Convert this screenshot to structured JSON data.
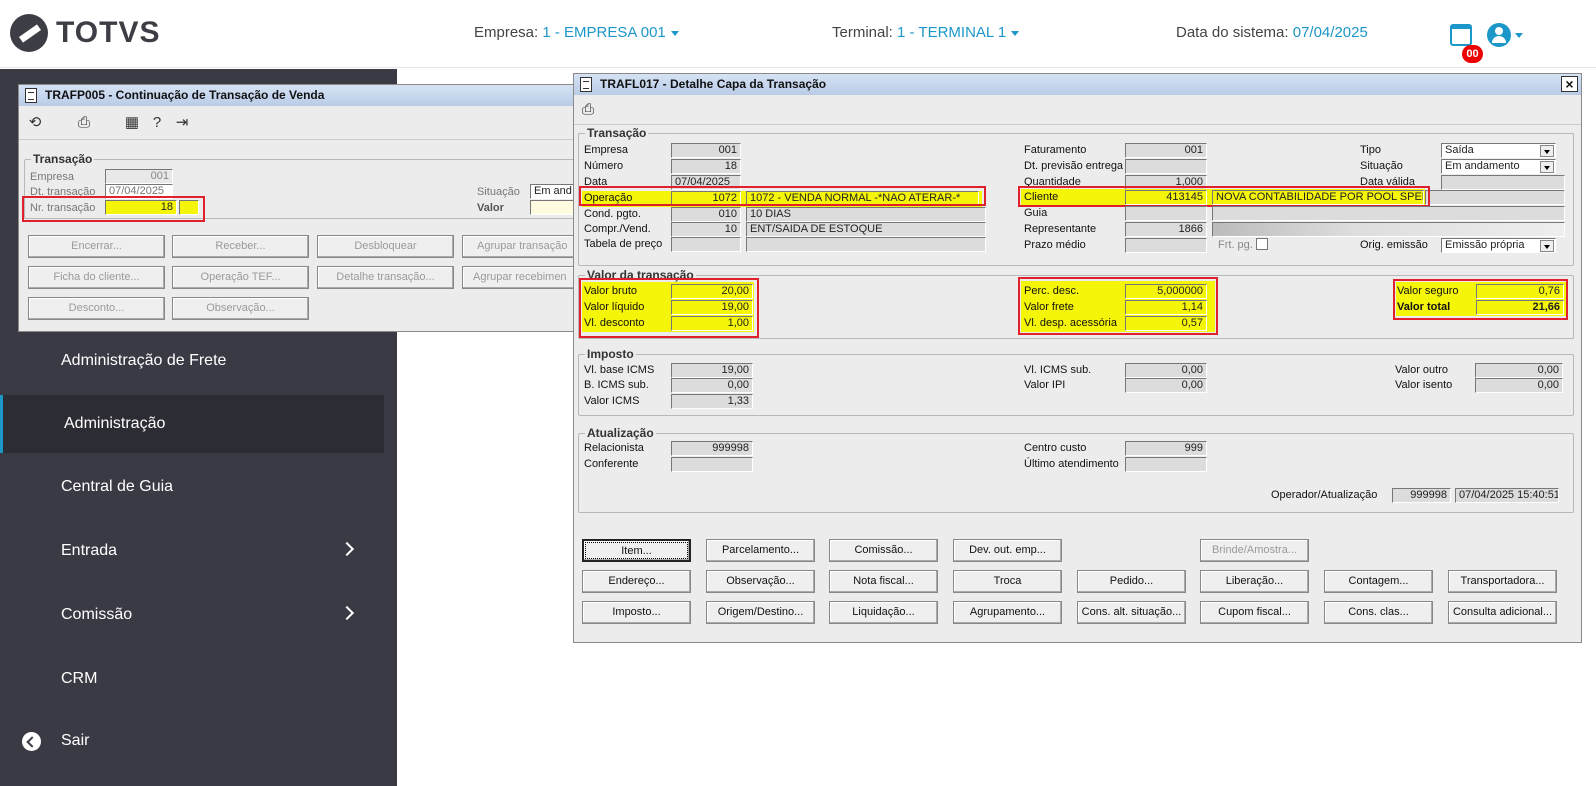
{
  "header": {
    "logo": "TOTVS",
    "empresa_label": "Empresa:",
    "empresa_value": "1 - EMPRESA 001",
    "terminal_label": "Terminal:",
    "terminal_value": "1 - TERMINAL 1",
    "data_label": "Data do sistema:",
    "data_value": "07/04/2025",
    "badge": "00"
  },
  "sidebar": {
    "items": [
      {
        "label": "Administração de Frete"
      },
      {
        "label": "Administração"
      },
      {
        "label": "Central de Guia"
      },
      {
        "label": "Entrada"
      },
      {
        "label": "Comissão"
      },
      {
        "label": "CRM"
      },
      {
        "label": "Sair"
      }
    ]
  },
  "w1": {
    "title": "TRAFP005 - Continuação de Transação de Venda",
    "group": "Transação",
    "empresa_label": "Empresa",
    "empresa": "001",
    "dt_label": "Dt. transação",
    "dt": "07/04/2025",
    "nr_label": "Nr. transação",
    "nr": "18",
    "situacao_label": "Situação",
    "situacao": "Em and",
    "valor_label": "Valor",
    "buttons": [
      "Encerrar...",
      "Receber...",
      "Desbloquear",
      "Agrupar transação",
      "Ficha do cliente...",
      "Operação TEF...",
      "Detalhe transação...",
      "Agrupar recebimen",
      "Desconto...",
      "Observação..."
    ]
  },
  "w2": {
    "title": "TRAFL017 - Detalhe Capa da Transação",
    "transacao": {
      "label": "Transação",
      "empresa_l": "Empresa",
      "empresa": "001",
      "numero_l": "Número",
      "numero": "18",
      "data_l": "Data",
      "data": "07/04/2025",
      "operacao_l": "Operação",
      "operacao": "1072",
      "operacao_desc": "1072 - VENDA NORMAL -*NAO ATERAR-*",
      "cond_l": "Cond. pgto.",
      "cond": "010",
      "cond_desc": "10 DIAS",
      "compr_l": "Compr./Vend.",
      "compr": "10",
      "compr_desc": "ENT/SAIDA DE ESTOQUE",
      "tabela_l": "Tabela de preço",
      "fat_l": "Faturamento",
      "fat": "001",
      "dtprev_l": "Dt. previsão entrega",
      "qtd_l": "Quantidade",
      "qtd": "1,000",
      "cliente_l": "Cliente",
      "cliente": "413145",
      "cliente_desc": "NOVA CONTABILIDADE POR POOL SPED",
      "guia_l": "Guia",
      "repr_l": "Representante",
      "repr": "1866",
      "prazo_l": "Prazo médio",
      "frt_l": "Frt. pg.",
      "tipo_l": "Tipo",
      "tipo": "Saída",
      "situacao_l": "Situação",
      "situacao": "Em andamento",
      "datav_l": "Data válida",
      "orig_l": "Orig. emissão",
      "orig": "Emissão própria"
    },
    "valor": {
      "label": "Valor da transação",
      "bruto_l": "Valor bruto",
      "bruto": "20,00",
      "liquido_l": "Valor líquido",
      "liquido": "19,00",
      "desc_l": "Vl. desconto",
      "desc": "1,00",
      "perc_l": "Perc. desc.",
      "perc": "5,000000",
      "frete_l": "Valor frete",
      "frete": "1,14",
      "desp_l": "Vl. desp. acessória",
      "desp": "0,57",
      "seguro_l": "Valor seguro",
      "seguro": "0,76",
      "total_l": "Valor total",
      "total": "21,66"
    },
    "imposto": {
      "label": "Imposto",
      "base_l": "Vl. base ICMS",
      "base": "19,00",
      "bsub_l": "B. ICMS sub.",
      "bsub": "0,00",
      "icms_l": "Valor ICMS",
      "icms": "1,33",
      "icmssub_l": "Vl. ICMS sub.",
      "icmssub": "0,00",
      "ipi_l": "Valor IPI",
      "ipi": "0,00",
      "outro_l": "Valor outro",
      "outro": "0,00",
      "isento_l": "Valor isento",
      "isento": "0,00"
    },
    "atual": {
      "label": "Atualização",
      "rel_l": "Relacionista",
      "rel": "999998",
      "conf_l": "Conferente",
      "cc_l": "Centro custo",
      "cc": "999",
      "ult_l": "Último atendimento",
      "op_l": "Operador/Atualização",
      "op": "999998",
      "op_dt": "07/04/2025 15:40:51"
    },
    "buttons": [
      "Item...",
      "Parcelamento...",
      "Comissão...",
      "Dev. out. emp...",
      "Brinde/Amostra...",
      "Endereço...",
      "Observação...",
      "Nota fiscal...",
      "Troca",
      "Pedido...",
      "Liberação...",
      "Contagem...",
      "Transportadora...",
      "Imposto...",
      "Origem/Destino...",
      "Liquidação...",
      "Agrupamento...",
      "Cons. alt. situação...",
      "Cupom fiscal...",
      "Cons. clas...",
      "Consulta adicional..."
    ]
  }
}
